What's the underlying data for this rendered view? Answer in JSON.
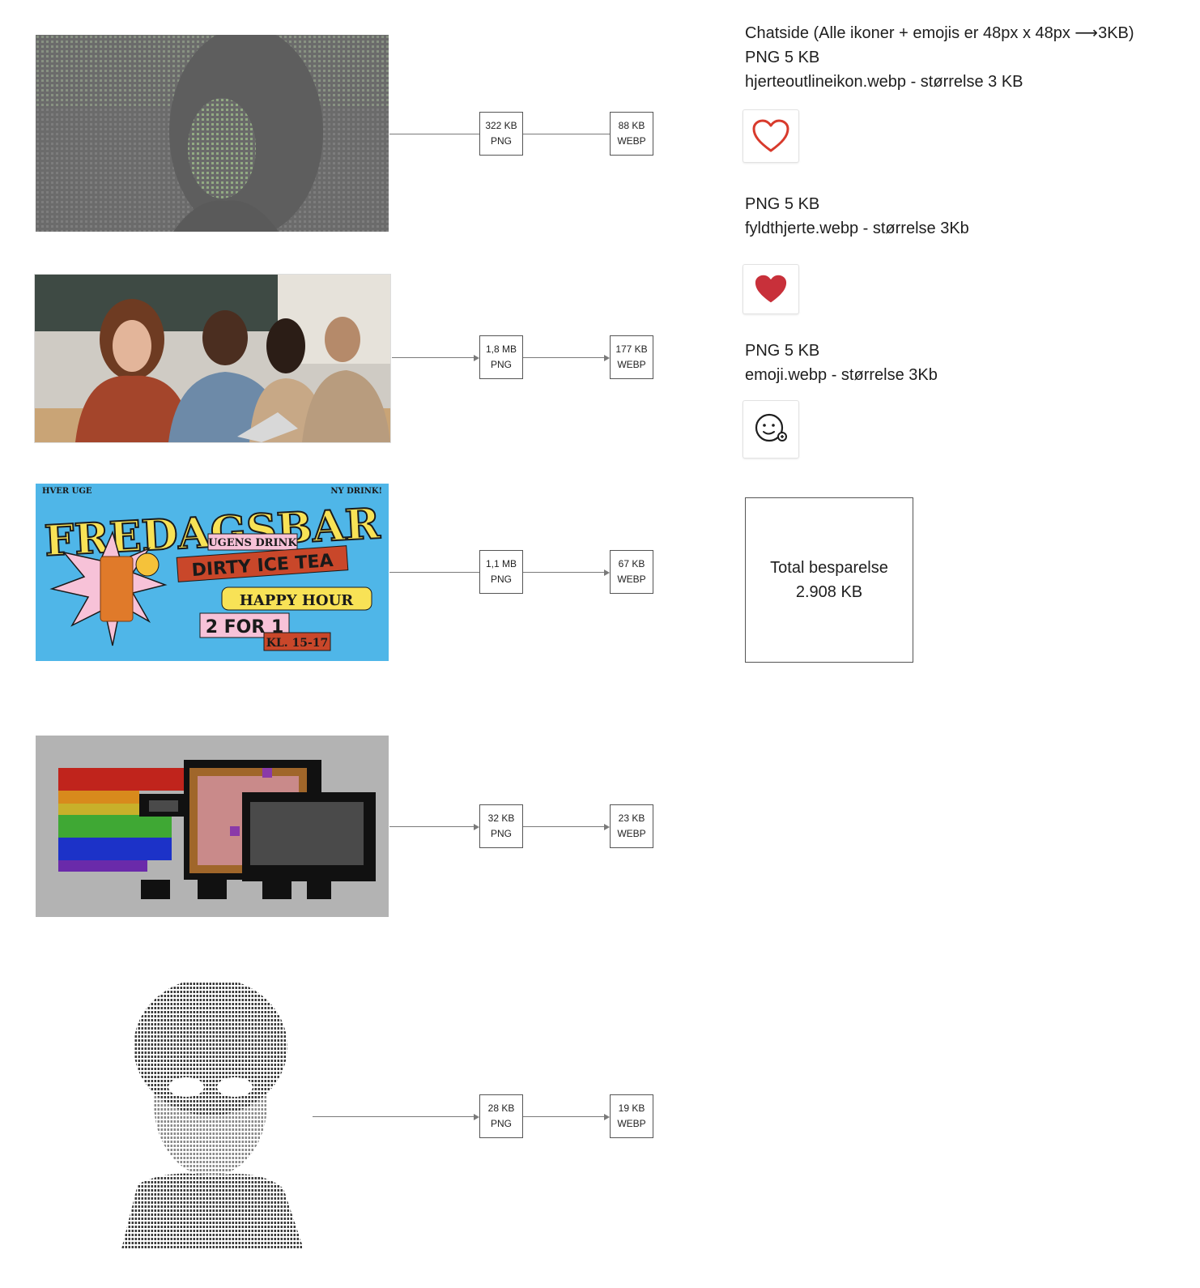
{
  "rows": [
    {
      "png": "322 KB",
      "png_label": "PNG",
      "webp": "88 KB",
      "webp_label": "WEBP"
    },
    {
      "png": "1,8 MB",
      "png_label": "PNG",
      "webp": "177 KB",
      "webp_label": "WEBP"
    },
    {
      "png": "1,1 MB",
      "png_label": "PNG",
      "webp": "67 KB",
      "webp_label": "WEBP"
    },
    {
      "png": "32 KB",
      "png_label": "PNG",
      "webp": "23 KB",
      "webp_label": "WEBP"
    },
    {
      "png": "28 KB",
      "png_label": "PNG",
      "webp": "19 KB",
      "webp_label": "WEBP"
    }
  ],
  "poster": {
    "hver_uge": "HVER UGE",
    "ny_drink": "NY DRINK!",
    "title": "FREDAGSBAR",
    "ugens_drink": "UGENS DRINK",
    "drink": "DIRTY ICE TEA",
    "happy_hour": "HAPPY HOUR",
    "offer": "2 FOR 1",
    "time": "KL. 15-17"
  },
  "chat": {
    "heading": "Chatside (Alle ikoner + emojis er 48px x 48px ⟶3KB)",
    "icons": [
      {
        "png": "PNG 5 KB",
        "file": "hjerteoutlineikon.webp - størrelse 3 KB",
        "icon": "heart-outline-icon"
      },
      {
        "png": "PNG 5 KB",
        "file": "fyldthjerte.webp - størrelse 3Kb",
        "icon": "heart-filled-icon"
      },
      {
        "png": "PNG 5 KB",
        "file": "emoji.webp - størrelse 3Kb",
        "icon": "smiley-emoji-icon"
      }
    ],
    "colors": {
      "heart_outline": "#d83a2c",
      "heart_filled": "#c8303a"
    }
  },
  "total": {
    "label": "Total besparelse",
    "value": "2.908 KB"
  }
}
